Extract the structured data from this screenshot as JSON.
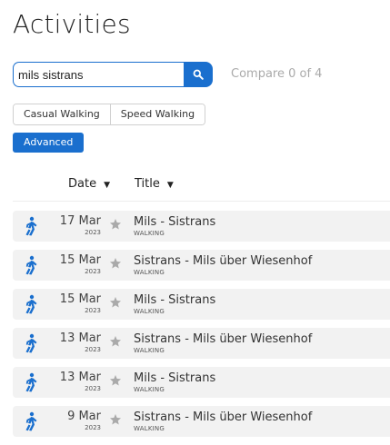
{
  "page": {
    "title": "Activities"
  },
  "search": {
    "value": "mils sistrans",
    "button_icon": "search-icon"
  },
  "compare": {
    "label": "Compare 0 of 4"
  },
  "filters": [
    {
      "label": "Casual Walking"
    },
    {
      "label": "Speed Walking"
    }
  ],
  "advanced": {
    "label": "Advanced"
  },
  "columns": {
    "date": {
      "label": "Date",
      "sort_icon": "caret-down-icon"
    },
    "title": {
      "label": "Title",
      "sort_icon": "caret-down-icon"
    }
  },
  "colors": {
    "accent": "#1a6fce",
    "row_bg": "#f2f2f2",
    "star": "#aaaaaa"
  },
  "activities": [
    {
      "date": "17 Mar",
      "year": "2023",
      "title": "Mils - Sistrans",
      "type": "WALKING",
      "icon": "walking-icon"
    },
    {
      "date": "15 Mar",
      "year": "2023",
      "title": "Sistrans - Mils über Wiesenhof",
      "type": "WALKING",
      "icon": "walking-icon"
    },
    {
      "date": "15 Mar",
      "year": "2023",
      "title": "Mils - Sistrans",
      "type": "WALKING",
      "icon": "walking-icon"
    },
    {
      "date": "13 Mar",
      "year": "2023",
      "title": "Sistrans - Mils über Wiesenhof",
      "type": "WALKING",
      "icon": "walking-icon"
    },
    {
      "date": "13 Mar",
      "year": "2023",
      "title": "Mils - Sistrans",
      "type": "WALKING",
      "icon": "walking-icon"
    },
    {
      "date": "9 Mar",
      "year": "2023",
      "title": "Sistrans - Mils über Wiesenhof",
      "type": "WALKING",
      "icon": "walking-icon"
    }
  ]
}
